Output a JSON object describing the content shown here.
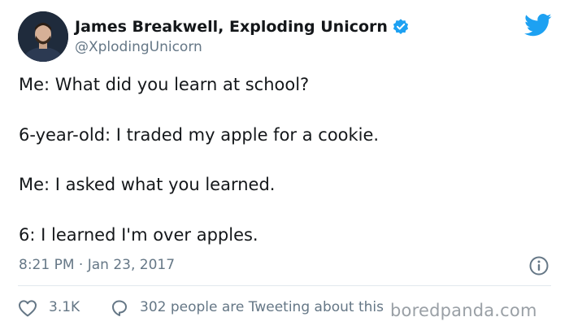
{
  "user": {
    "display_name": "James Breakwell, Exploding Unicorn",
    "handle": "@XplodingUnicorn"
  },
  "tweet": {
    "lines": [
      "Me: What did you learn at school?",
      "6-year-old: I traded my apple for a cookie.",
      "Me: I asked what you learned.",
      "6: I learned I'm over apples."
    ],
    "timestamp": "8:21 PM · Jan 23, 2017"
  },
  "actions": {
    "like_count": "3.1K",
    "reply_text": "302 people are Tweeting about this"
  },
  "watermark": "boredpanda.com",
  "icons": {
    "avatar": "avatar-photo",
    "verified": "verified-badge-icon",
    "brand": "twitter-bird-icon",
    "info": "info-icon",
    "like": "heart-icon",
    "reply": "comment-icon"
  },
  "colors": {
    "twitter_blue": "#1da1f2",
    "secondary_text": "#657786",
    "primary_text": "#14171a",
    "divider": "#e1e8ed",
    "watermark": "#9aa0a6"
  }
}
